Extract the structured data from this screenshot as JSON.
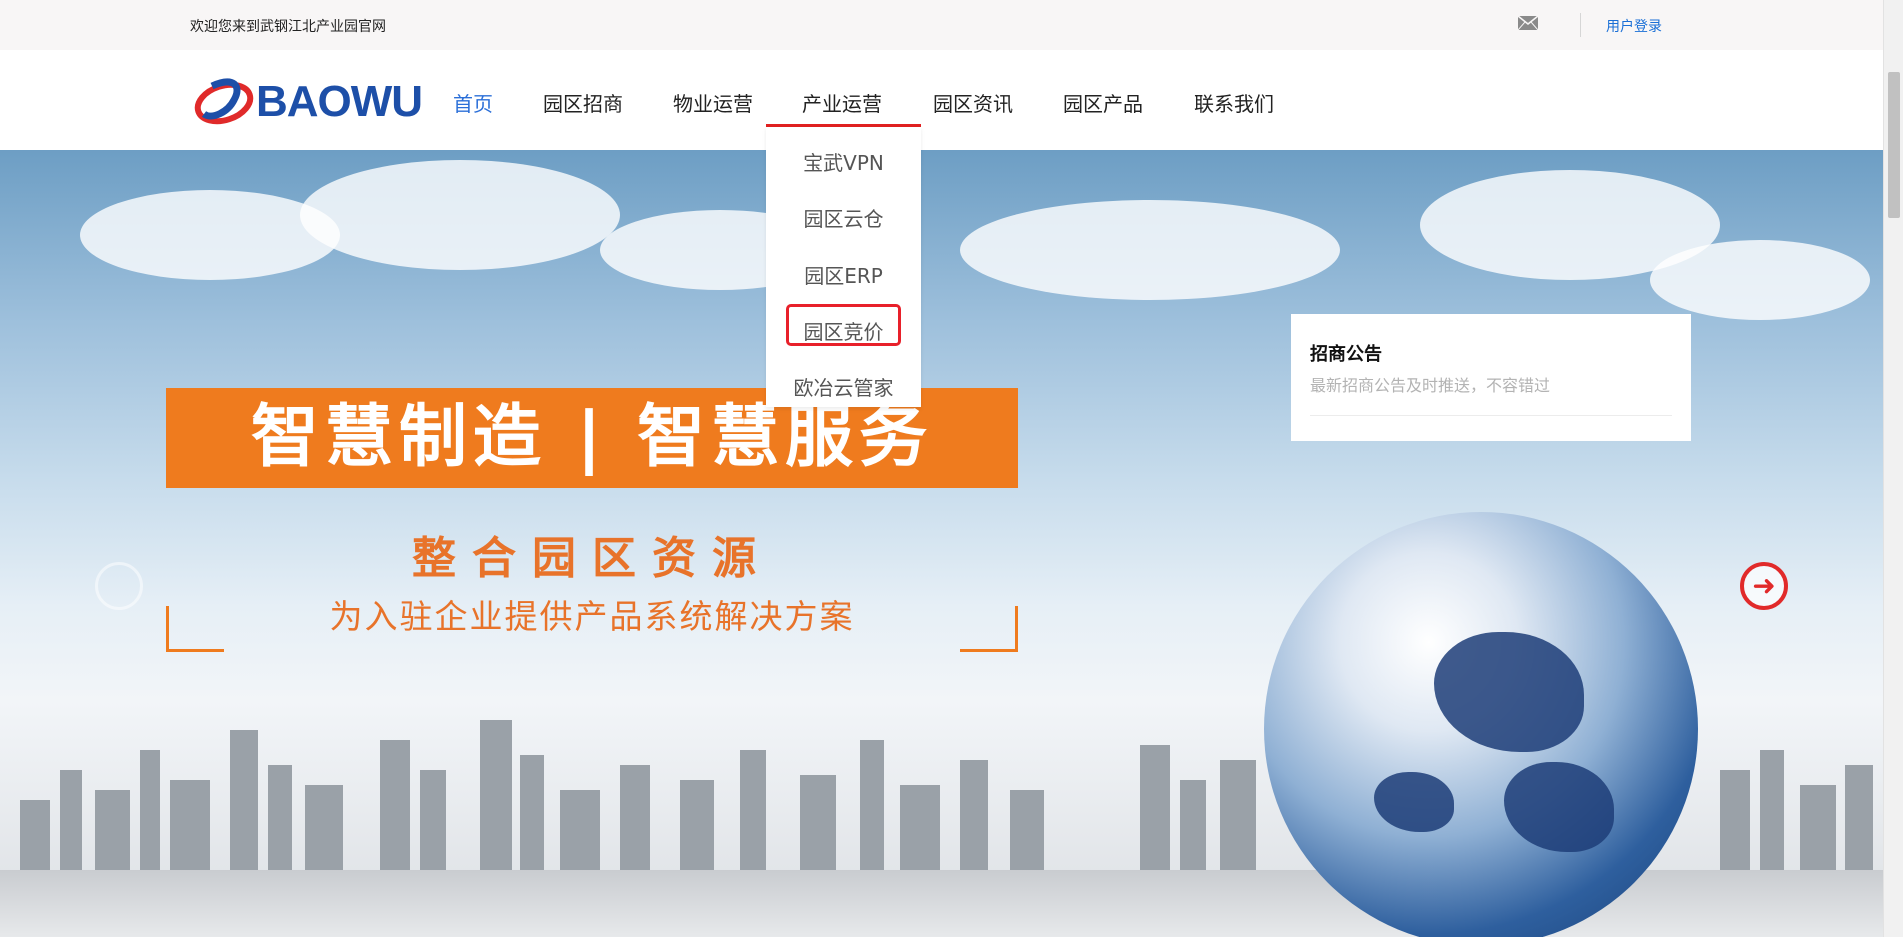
{
  "topbar": {
    "welcome": "欢迎您来到武钢江北产业园官网",
    "mail_icon": "mail-icon",
    "login": "用户登录"
  },
  "header": {
    "logo_text": "BAOWU",
    "nav": [
      {
        "label": "首页",
        "active": true
      },
      {
        "label": "园区招商",
        "active": false
      },
      {
        "label": "物业运营",
        "active": false
      },
      {
        "label": "产业运营",
        "active": false
      },
      {
        "label": "园区资讯",
        "active": false
      },
      {
        "label": "园区产品",
        "active": false
      },
      {
        "label": "联系我们",
        "active": false
      }
    ],
    "dropdown": [
      {
        "label": "宝武VPN"
      },
      {
        "label": "园区云仓"
      },
      {
        "label": "园区ERP"
      },
      {
        "label": "园区竞价",
        "highlighted": true
      },
      {
        "label": "欧冶云管家"
      }
    ]
  },
  "banner": {
    "slogan": "智慧制造 | 智慧服务",
    "subtitle": "整合园区资源",
    "description": "为入驻企业提供产品系统解决方案",
    "next_icon": "arrow-right-icon"
  },
  "notice": {
    "title": "招商公告",
    "subtitle": "最新招商公告及时推送，不容错过"
  },
  "colors": {
    "accent": "#2b6fd8",
    "highlight": "#e8202a",
    "orange": "#ef7b1e",
    "brand_blue": "#1d4fa8"
  }
}
